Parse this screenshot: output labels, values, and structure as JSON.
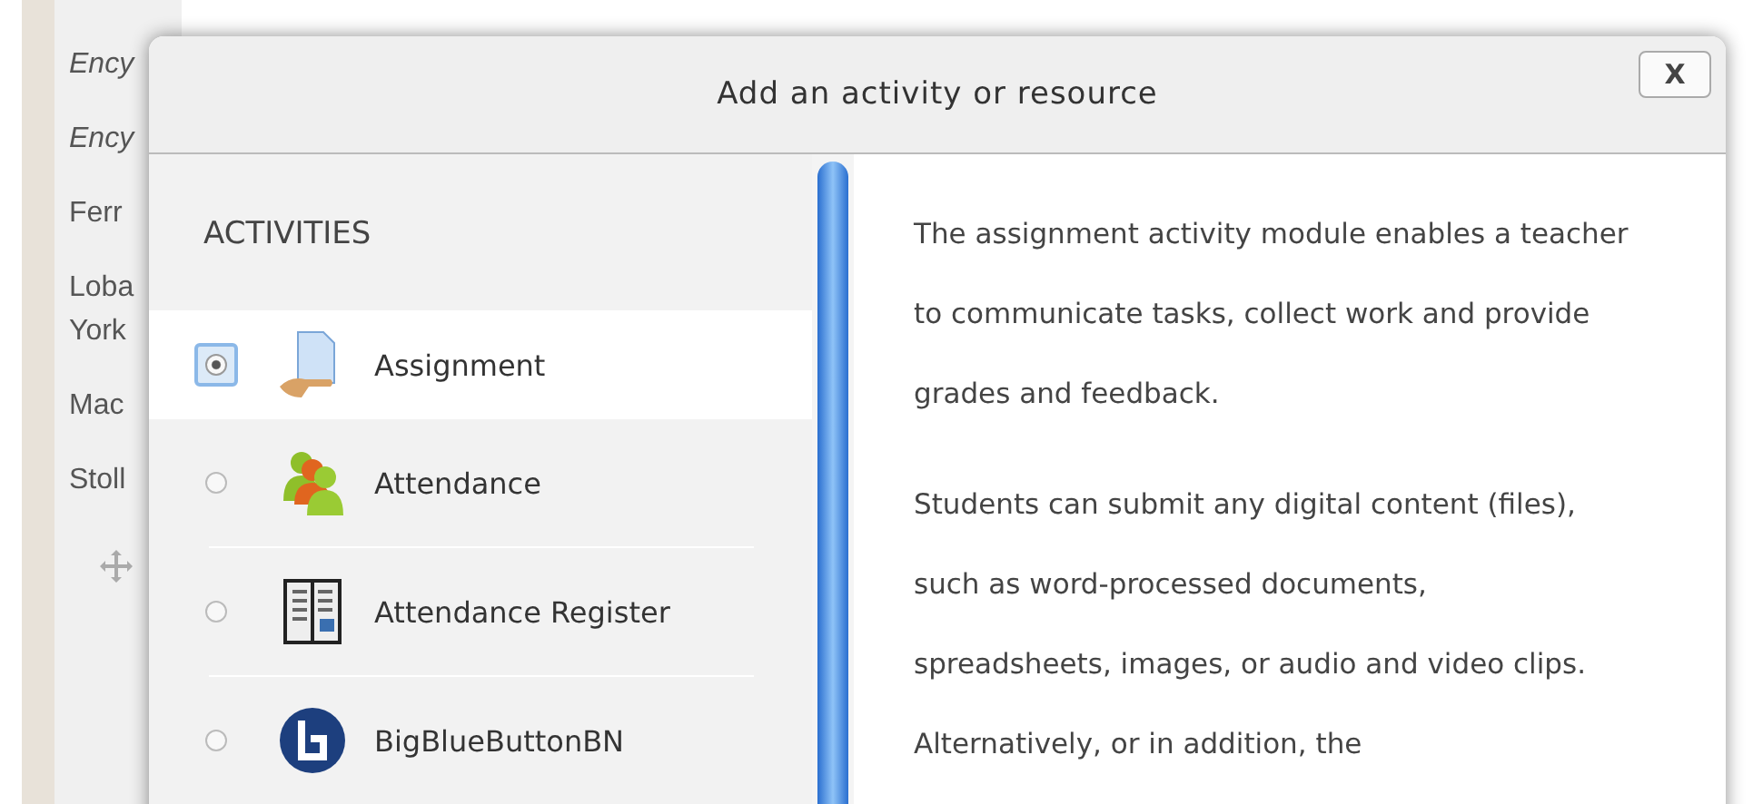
{
  "background_lines": [
    {
      "text": "Ency",
      "italic": true
    },
    {
      "text": "Ency",
      "italic": true
    },
    {
      "text": "Ferr",
      "italic": false
    },
    {
      "text": "Loba",
      "italic": false
    },
    {
      "text": "York",
      "italic": false
    },
    {
      "text": "Mac",
      "italic": false
    },
    {
      "text": "Stoll",
      "italic": false
    }
  ],
  "dialog": {
    "title": "Add an activity or resource",
    "close": "X",
    "section": "ACTIVITIES",
    "items": [
      {
        "label": "Assignment",
        "kind": "assignment",
        "selected": true
      },
      {
        "label": "Attendance",
        "kind": "attendance",
        "selected": false
      },
      {
        "label": "Attendance Register",
        "kind": "register",
        "selected": false
      },
      {
        "label": "BigBlueButtonBN",
        "kind": "bigbluebutton",
        "selected": false
      }
    ],
    "description": [
      "The assignment activity module enables a teacher to communicate tasks, collect work and provide grades and feedback.",
      "Students can submit any digital content (files), such as word-processed documents, spreadsheets, images, or audio and video clips. Alternatively, or in addition, the"
    ]
  }
}
